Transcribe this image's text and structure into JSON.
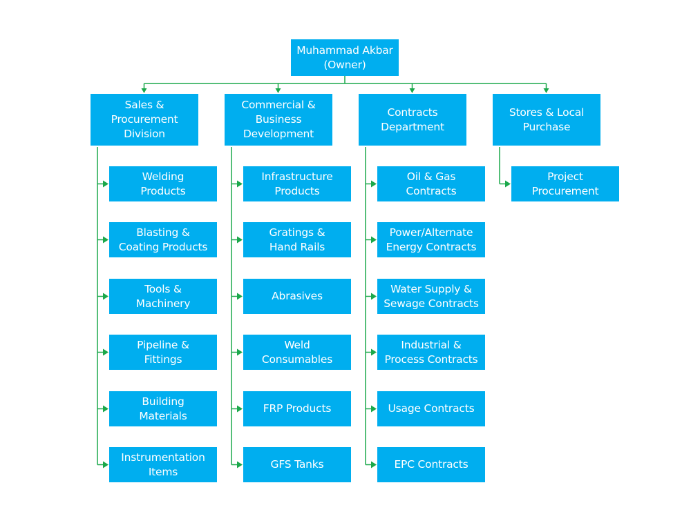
{
  "colors": {
    "box_fill": "#00AEEF",
    "box_text": "#FFFFFF",
    "connector": "#1BA84B",
    "background": "#FFFFFF"
  },
  "root": {
    "label": "Muhammad Akbar\n(Owner)"
  },
  "departments": [
    {
      "label": "Sales &\nProcurement\nDivision",
      "children": [
        "Welding\nProducts",
        "Blasting &\nCoating Products",
        "Tools &\nMachinery",
        "Pipeline &\nFittings",
        "Building\nMaterials",
        "Instrumentation\nItems"
      ]
    },
    {
      "label": "Commercial &\nBusiness\nDevelopment",
      "children": [
        "Infrastructure\nProducts",
        "Gratings &\nHand Rails",
        "Abrasives",
        "Weld\nConsumables",
        "FRP Products",
        "GFS Tanks"
      ]
    },
    {
      "label": "Contracts\nDepartment",
      "children": [
        "Oil & Gas\nContracts",
        "Power/Alternate\nEnergy Contracts",
        "Water Supply &\nSewage Contracts",
        "Industrial &\nProcess Contracts",
        "Usage Contracts",
        "EPC Contracts"
      ]
    },
    {
      "label": "Stores & Local\nPurchase",
      "children": [
        "Project\nProcurement"
      ]
    }
  ]
}
